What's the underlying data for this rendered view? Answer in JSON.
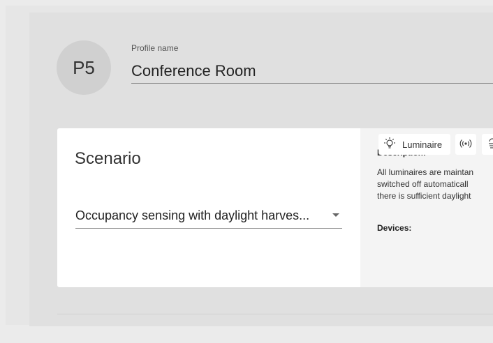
{
  "profile": {
    "avatar_text": "P5",
    "name_label": "Profile name",
    "name_value": "Conference Room"
  },
  "scenario": {
    "title": "Scenario",
    "selected": "Occupancy sensing with daylight harves..."
  },
  "details": {
    "description_label": "Description:",
    "description_lines": [
      "All luminaires are maintan",
      "switched off automaticall",
      "there is sufficient daylight"
    ],
    "devices_label": "Devices:",
    "devices": [
      {
        "label": "Luminaire",
        "icon": "luminaire-icon"
      },
      {
        "label": "",
        "icon": "sensor-icon"
      },
      {
        "label": "",
        "icon": "daylight-sensor-icon"
      }
    ]
  }
}
